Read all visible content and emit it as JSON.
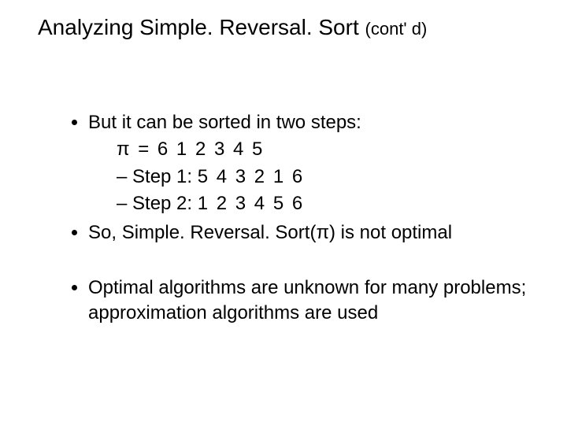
{
  "title": {
    "main": "Analyzing Simple. Reversal. Sort ",
    "cont": "(cont' d)"
  },
  "bullets": {
    "b1": "But it can be sorted in two steps:",
    "pi_line": "π   =  6 1 2 3 4 5",
    "step1_label": "– Step 1:  ",
    "step1_val": "5 4 3 2 1 6",
    "step2_label": "– Step 2:  ",
    "step2_val": "1 2 3 4 5 6",
    "b2_pre": "So, Simple. Reversal. Sort(",
    "b2_pi": "π",
    "b2_post": ") is not optimal",
    "b3": "Optimal algorithms are unknown for many problems; approximation algorithms are used"
  }
}
